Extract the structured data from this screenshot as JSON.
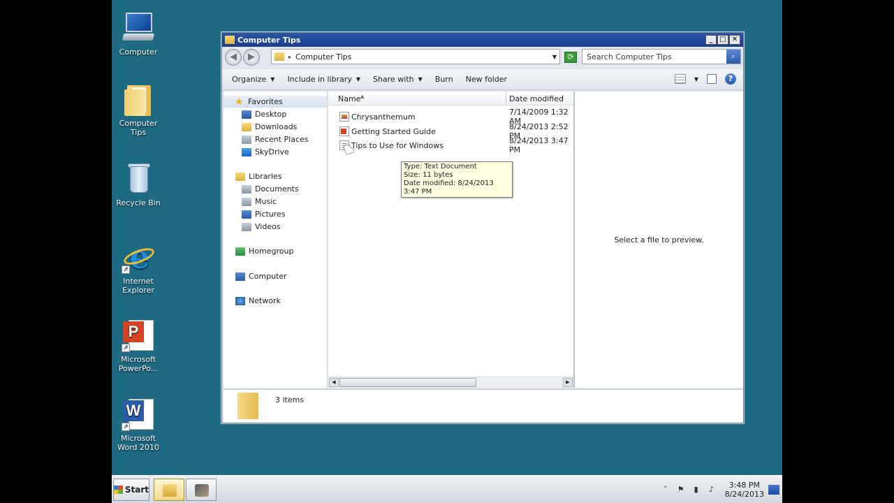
{
  "desktop": {
    "icons": [
      {
        "label": "Computer"
      },
      {
        "label": "Computer Tips"
      },
      {
        "label": "Recycle Bin"
      },
      {
        "label": "Internet Explorer"
      },
      {
        "label": "Microsoft PowerPo..."
      },
      {
        "label": "Microsoft Word 2010"
      }
    ]
  },
  "window": {
    "title": "Computer Tips",
    "controls": {
      "minimize": "_",
      "maximize": "□",
      "close": "✕"
    },
    "address": {
      "path": "Computer Tips"
    },
    "search": {
      "placeholder": "Search Computer Tips"
    },
    "toolbar": {
      "organize": "Organize",
      "include_in_library": "Include in library",
      "share_with": "Share with",
      "burn": "Burn",
      "new_folder": "New folder"
    },
    "nav": {
      "favorites": "Favorites",
      "desktop": "Desktop",
      "downloads": "Downloads",
      "recent_places": "Recent Places",
      "skydrive": "SkyDrive",
      "libraries": "Libraries",
      "documents": "Documents",
      "music": "Music",
      "pictures": "Pictures",
      "videos": "Videos",
      "homegroup": "Homegroup",
      "computer": "Computer",
      "network": "Network"
    },
    "columns": {
      "name": "Name",
      "date_modified": "Date modified"
    },
    "files": [
      {
        "name": "Chrysanthemum",
        "date": "7/14/2009 1:32 AM",
        "icon": "image-file-icon"
      },
      {
        "name": "Getting Started Guide",
        "date": "8/24/2013 2:52 PM",
        "icon": "powerpoint-file-icon"
      },
      {
        "name": "Tips to Use for Windows",
        "date": "8/24/2013 3:47 PM",
        "icon": "text-file-icon"
      }
    ],
    "tooltip": {
      "type": "Type: Text Document",
      "size": "Size: 11 bytes",
      "date": "Date modified: 8/24/2013 3:47 PM"
    },
    "preview": {
      "message": "Select a file to preview."
    },
    "details": {
      "count": "3 items"
    }
  },
  "taskbar": {
    "start": "Start",
    "clock": {
      "time": "3:48 PM",
      "date": "8/24/2013"
    }
  },
  "colors": {
    "desktop": "#1d6a82",
    "titlebar": "#1a3e8c",
    "taskbar": "#d4d8de"
  }
}
